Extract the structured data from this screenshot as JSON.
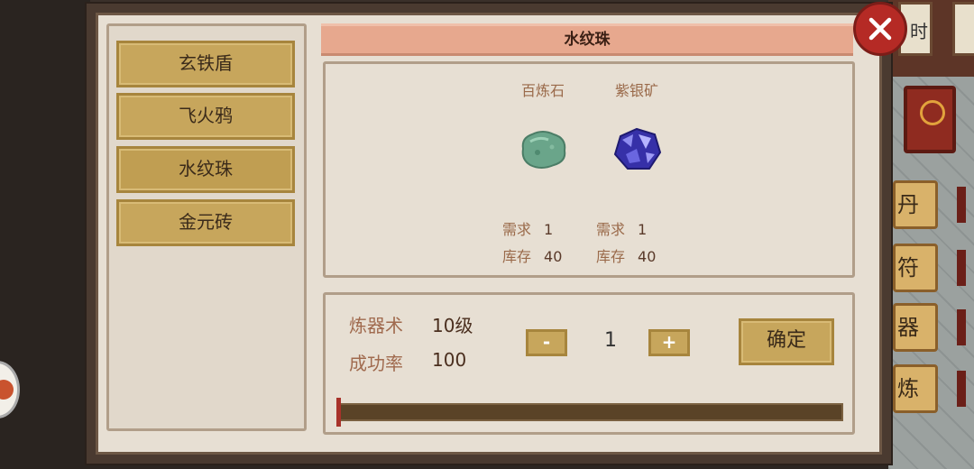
{
  "background": {
    "scroll_char": "时",
    "side_buttons": [
      "丹",
      "符",
      "器",
      "炼"
    ]
  },
  "recipe_list": {
    "items": [
      {
        "label": "玄铁盾"
      },
      {
        "label": "飞火鸦"
      },
      {
        "label": "水纹珠"
      },
      {
        "label": "金元砖"
      }
    ]
  },
  "selected_item": {
    "title": "水纹珠"
  },
  "materials": [
    {
      "name": "百炼石",
      "icon": "green-stone-icon",
      "require_label": "需求",
      "require": "1",
      "stock_label": "库存",
      "stock": "40"
    },
    {
      "name": "紫银矿",
      "icon": "purple-ore-icon",
      "require_label": "需求",
      "require": "1",
      "stock_label": "库存",
      "stock": "40"
    }
  ],
  "craft": {
    "skill_label": "炼器术",
    "skill_value": "10级",
    "rate_label": "成功率",
    "rate_value": "100",
    "minus_label": "-",
    "plus_label": "+",
    "quantity": "1",
    "confirm_label": "确定",
    "progress": 0
  },
  "colors": {
    "accent_gold": "#c7a65c",
    "title_bar": "#e7a88e",
    "close_red": "#b52a25"
  }
}
